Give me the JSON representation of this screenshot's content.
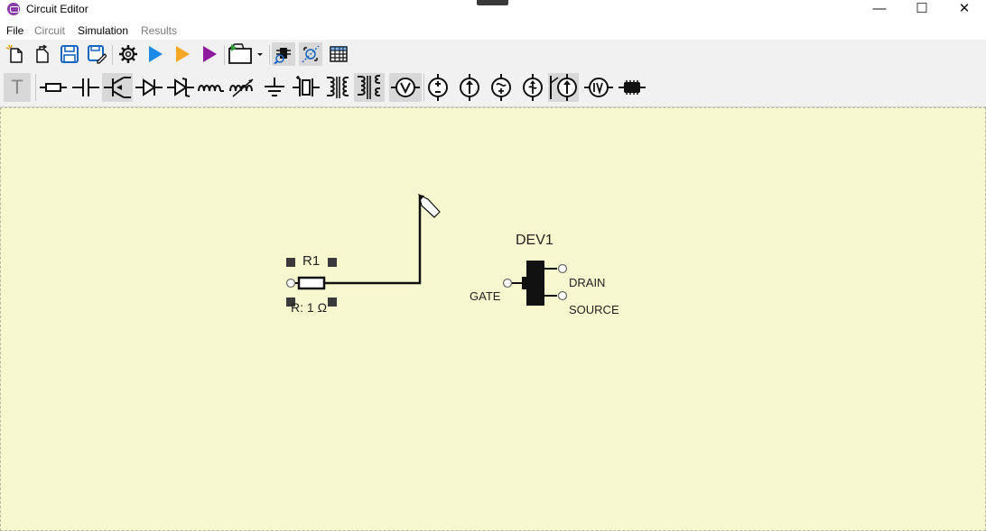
{
  "window": {
    "title": "Circuit Editor",
    "minimize_glyph": "—",
    "maximize_glyph": "☐",
    "close_glyph": "✕"
  },
  "menu": {
    "items": [
      {
        "label": "File",
        "enabled": true
      },
      {
        "label": "Circuit",
        "enabled": false
      },
      {
        "label": "Simulation",
        "enabled": true
      },
      {
        "label": "Results",
        "enabled": false
      }
    ]
  },
  "toolbar_main": {
    "buttons": [
      "new-file-icon",
      "open-file-icon",
      "save-icon",
      "save-as-icon",
      "settings-icon",
      "run-simulation-icon",
      "pause-simulation-icon",
      "step-simulation-icon",
      "export-icon",
      "probe-icon",
      "measure-icon",
      "table-icon"
    ]
  },
  "toolbar_components": {
    "text_tool_label": "T",
    "buttons": [
      "resistor-icon",
      "capacitor-icon",
      "transistor-icon",
      "diode-icon",
      "zener-diode-icon",
      "inductor-icon",
      "variable-inductor-icon",
      "ground-icon",
      "crystal-icon",
      "transformer-icon",
      "transformer-3-icon",
      "voltmeter-icon",
      "voltage-source-icon",
      "current-source-icon",
      "ac-source-icon",
      "dependent-source-icon",
      "switch-source-icon",
      "iv-meter-icon",
      "chip-icon"
    ]
  },
  "colors": {
    "canvas_bg": "#f8f8d0",
    "run_blue": "#1e88e5",
    "run_orange": "#f5a623",
    "run_purple": "#8e1a9e",
    "app_icon": "#8a3fa8"
  },
  "circuit": {
    "resistor": {
      "name": "R1",
      "value_label": "R: 1 Ω"
    },
    "device": {
      "name": "DEV1",
      "pins": {
        "gate": "GATE",
        "drain": "DRAIN",
        "source": "SOURCE"
      }
    }
  }
}
